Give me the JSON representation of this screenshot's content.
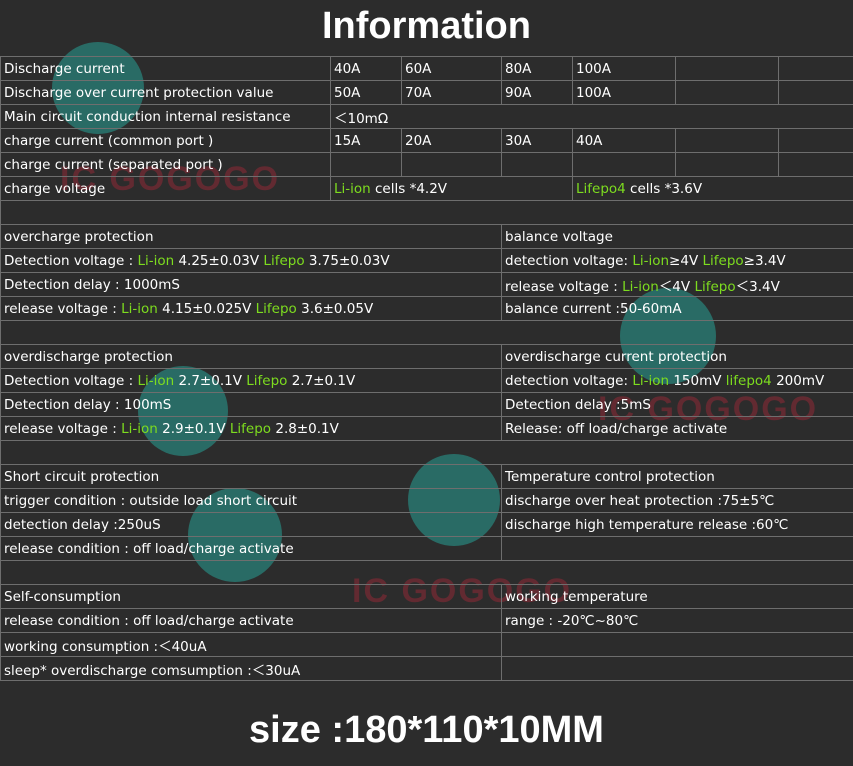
{
  "title": "Information",
  "spec_table": {
    "rows": [
      {
        "label": "Discharge current",
        "values": [
          "40A",
          "60A",
          "80A",
          "100A",
          "",
          ""
        ]
      },
      {
        "label": "Discharge over current protection  value",
        "values": [
          "50A",
          "70A",
          "90A",
          "100A",
          "",
          ""
        ]
      },
      {
        "label": "Main circuit conduction internal resistance",
        "value": "＜10mΩ"
      },
      {
        "label": "charge current (common port )",
        "values": [
          "15A",
          "20A",
          "30A",
          "40A",
          "",
          ""
        ]
      },
      {
        "label": "charge current (separated port )",
        "values": [
          "",
          "",
          "",
          "",
          "",
          ""
        ]
      },
      {
        "label": "charge voltage",
        "li": "Li-ion",
        "li_rest": " cells *4.2V",
        "lf": "Lifepo4",
        "lf_rest": " cells *3.6V"
      }
    ]
  },
  "overcharge": {
    "heading": "overcharge protection",
    "det_prefix": "Detection voltage : ",
    "det_li": "Li-ion",
    "det_li_val": " 4.25±0.03V  ",
    "det_lf": "Lifepo",
    "det_lf_val": " 3.75±0.03V",
    "delay": "Detection delay : 1000mS",
    "rel_prefix": "release voltage : ",
    "rel_li": "Li-ion",
    "rel_li_val": " 4.15±0.025V   ",
    "rel_lf": "Lifepo",
    "rel_lf_val": " 3.6±0.05V"
  },
  "balance": {
    "heading": "balance voltage",
    "det_prefix": "detection voltage: ",
    "det_li": "Li-ion",
    "det_li_val": "≥4V  ",
    "det_lf": "Lifepo",
    "det_lf_val": "≥3.4V",
    "rel_prefix": "release voltage : ",
    "rel_li": "Li-ion",
    "rel_li_val": "＜4V  ",
    "rel_lf": "Lifepo",
    "rel_lf_val": "＜3.4V",
    "current": "balance current :50-60mA"
  },
  "overdischarge": {
    "heading": "overdischarge protection",
    "det_prefix": "Detection voltage : ",
    "det_li": "Li-ion",
    "det_li_val": " 2.7±0.1V   ",
    "det_lf": "Lifepo",
    "det_lf_val": " 2.7±0.1V",
    "delay": "Detection delay : 100mS",
    "rel_prefix": "release voltage : ",
    "rel_li": "Li-ion",
    "rel_li_val": " 2.9±0.1V   ",
    "rel_lf": "Lifepo",
    "rel_lf_val": " 2.8±0.1V"
  },
  "od_current": {
    "heading": "overdischarge current protection",
    "det_prefix": "detection voltage: ",
    "det_li": "Li-ion",
    "det_li_val": " 150mV  ",
    "det_lf": "lifepo4",
    "det_lf_val": " 200mV",
    "delay": "Detection delay :5mS",
    "release": "Release: off load/charge activate"
  },
  "short_circuit": {
    "heading": "Short circuit protection",
    "trigger": "trigger condition : outside load short circuit",
    "delay": "detection delay :250uS",
    "release": "release condition : off load/charge activate"
  },
  "temperature": {
    "heading": "Temperature control protection",
    "heat": "discharge over heat protection :75±5℃",
    "release": "discharge high temperature release :60℃"
  },
  "self_consumption": {
    "heading": "Self-consumption",
    "release": "release condition : off load/charge activate",
    "working": "working consumption :＜40uA",
    "sleep": "sleep* overdischarge comsumption :＜30uA"
  },
  "working_temp": {
    "heading": "working  temperature",
    "range": "range : -20℃~80℃"
  },
  "watermark_text": "IC GOGOGO",
  "size": "size :180*110*10MM",
  "colors": {
    "background": "#2c2c2c",
    "text": "#ffffff",
    "accent_green": "#7ddc1f",
    "grid": "#6e6e6e"
  }
}
